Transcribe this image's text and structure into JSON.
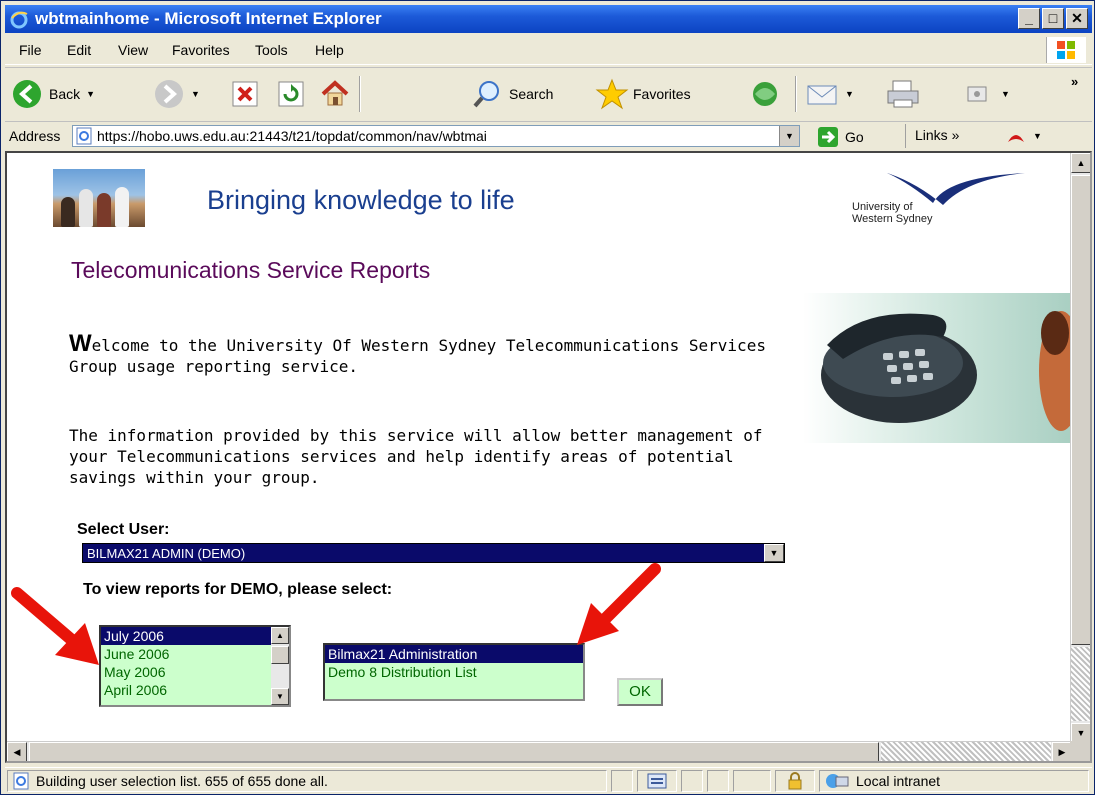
{
  "window": {
    "title": "wbtmainhome - Microsoft Internet Explorer",
    "minimize_label": "_",
    "maximize_label": "□",
    "close_label": "✕"
  },
  "menu": [
    "File",
    "Edit",
    "View",
    "Favorites",
    "Tools",
    "Help"
  ],
  "toolbar": {
    "back_label": "Back",
    "search_label": "Search",
    "favorites_label": "Favorites",
    "more_label": "»"
  },
  "address": {
    "label": "Address",
    "url": "https://hobo.uws.edu.au:21443/t21/topdat/common/nav/wbtmai",
    "go_label": "Go",
    "links_label": "Links »"
  },
  "page": {
    "tagline": "Bringing knowledge to life",
    "logo_text_line1": "University of",
    "logo_text_line2": "Western Sydney",
    "heading": "Telecomunications Service Reports",
    "welcome_first_letter": "W",
    "welcome_rest": "elcome to the University Of Western Sydney Telecommunications Services Group usage reporting service.",
    "info": "The information provided by this service will allow better management of your Telecommunications services and help identify areas of potential savings within your group.",
    "select_user_label": "Select User:",
    "selected_user": "BILMAX21 ADMIN (DEMO)",
    "view_reports_label": "To view reports for DEMO, please select:",
    "months": [
      "July 2006",
      "June 2006",
      "May 2006",
      "April 2006"
    ],
    "selected_month": "July 2006",
    "lists": [
      "Bilmax21 Administration",
      "Demo 8 Distribution List"
    ],
    "selected_list": "Bilmax21 Administration",
    "ok_label": "OK"
  },
  "status": {
    "text": "Building user selection list. 655 of 655 done all.",
    "zone": "Local intranet"
  },
  "colors": {
    "heading": "#5a0a5a",
    "tagline": "#1a3f8f",
    "list_bg": "#ccffcc",
    "selected_bg": "#0a0a6a",
    "arrow": "#e8140a"
  }
}
